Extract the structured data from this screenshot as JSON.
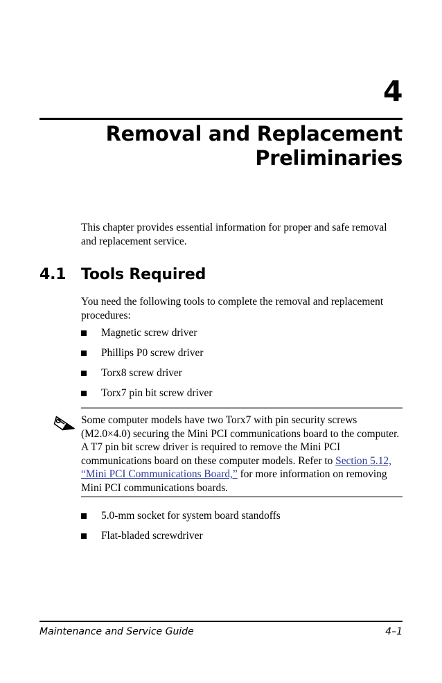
{
  "document": {
    "chapter_number": "4",
    "chapter_title_line1": "Removal and Replacement",
    "chapter_title_line2": "Preliminaries",
    "intro_paragraph": "This chapter provides essential information for proper and safe removal and replacement service."
  },
  "section": {
    "number": "4.1",
    "title": "Tools Required",
    "intro": "You need the following tools to complete the removal and replacement procedures:"
  },
  "tools_list": [
    {
      "label": "Magnetic screw driver"
    },
    {
      "label": "Phillips P0 screw driver"
    },
    {
      "label": "Torx8 screw driver"
    },
    {
      "label": "Torx7 pin bit screw driver"
    }
  ],
  "note": {
    "icon": "pencil-icon",
    "text_before_link": "Some computer models have two Torx7 with pin security screws (M2.0×4.0) securing the Mini PCI communications board to the computer. A T7 pin bit screw driver is required to remove the Mini PCI communications board on these computer models. Refer to ",
    "link_text": "Section 5.12, “Mini PCI Communications Board,”",
    "text_after_link": " for more information on removing Mini PCI communications boards.",
    "link_color": "#2b3a9c"
  },
  "extra_list": [
    {
      "label": "5.0-mm socket for system board standoffs"
    },
    {
      "label": "Flat-bladed screwdriver"
    }
  ],
  "footer": {
    "guide_title": "Maintenance and Service Guide",
    "page_number": "4–1"
  }
}
